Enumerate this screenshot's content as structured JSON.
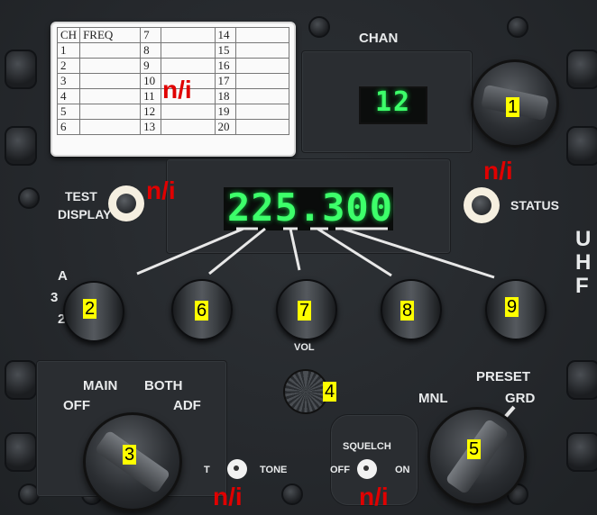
{
  "card": {
    "h_ch": "CH",
    "h_freq": "FREQ",
    "rows": [
      [
        "1",
        "",
        "7",
        "",
        "14",
        ""
      ],
      [
        "2",
        "",
        "8",
        "",
        "15",
        ""
      ],
      [
        "3",
        "",
        "9",
        "",
        "16",
        ""
      ],
      [
        "4",
        "",
        "10",
        "",
        "17",
        ""
      ],
      [
        "5",
        "",
        "11",
        "",
        "18",
        ""
      ],
      [
        "6",
        "",
        "12",
        "",
        "19",
        ""
      ],
      [
        "",
        "",
        "13",
        "",
        "20",
        ""
      ]
    ]
  },
  "chan": {
    "label": "CHAN",
    "value": "12"
  },
  "freq_display": "225.300",
  "test_display": {
    "line1": "TEST",
    "line2": "DISPLAY"
  },
  "status": "STATUS",
  "side_letters": [
    "U",
    "H",
    "F"
  ],
  "mode_labels": {
    "a": "A",
    "three": "3",
    "two": "2"
  },
  "vol": "VOL",
  "function": {
    "main": "MAIN",
    "off": "OFF",
    "both": "BOTH",
    "adf": "ADF"
  },
  "preset": {
    "preset": "PRESET",
    "mnl": "MNL",
    "grd": "GRD"
  },
  "tone": {
    "t": "T",
    "tone": "TONE"
  },
  "squelch": {
    "label": "SQUELCH",
    "off": "OFF",
    "on": "ON"
  },
  "badges": {
    "b1": "1",
    "b2": "2",
    "b3": "3",
    "b4": "4",
    "b5": "5",
    "b6": "6",
    "b7": "7",
    "b8": "8",
    "b9": "9"
  },
  "na": "n/i",
  "colors": {
    "display_green": "#3dff6a",
    "badge_yellow": "#ffff00",
    "na_red": "#e00000"
  }
}
